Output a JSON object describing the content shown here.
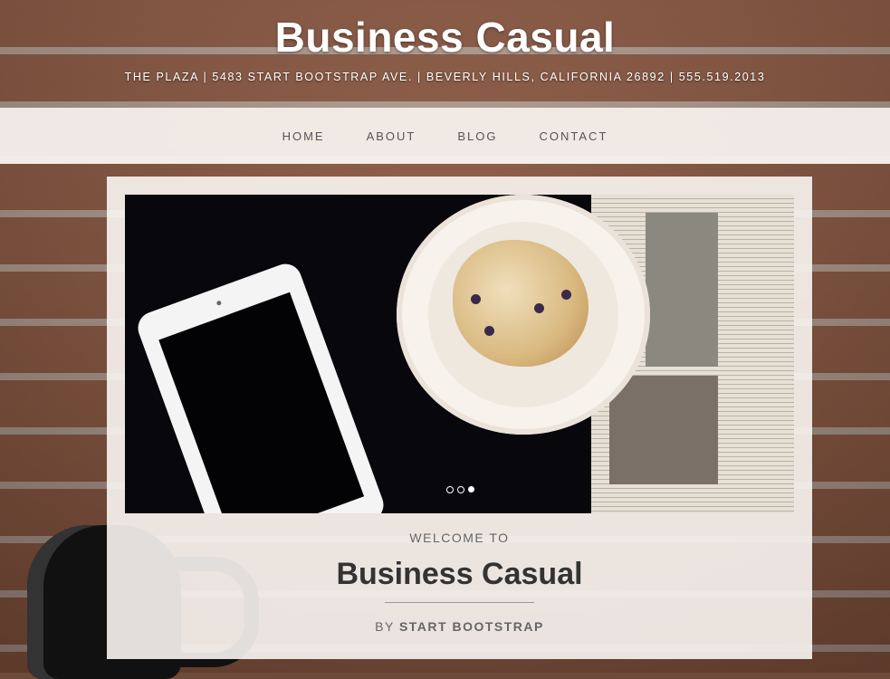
{
  "header": {
    "brand": "Business Casual",
    "address": "THE PLAZA | 5483 START BOOTSTRAP AVE. | BEVERLY HILLS, CALIFORNIA 26892 | 555.519.2013"
  },
  "nav": {
    "items": [
      {
        "label": "HOME"
      },
      {
        "label": "ABOUT"
      },
      {
        "label": "BLOG"
      },
      {
        "label": "CONTACT"
      }
    ]
  },
  "carousel": {
    "slide_count": 3,
    "active_index": 2
  },
  "intro": {
    "welcome": "WELCOME TO",
    "title": "Business Casual",
    "by_prefix": "BY",
    "by_name": "START BOOTSTRAP"
  }
}
